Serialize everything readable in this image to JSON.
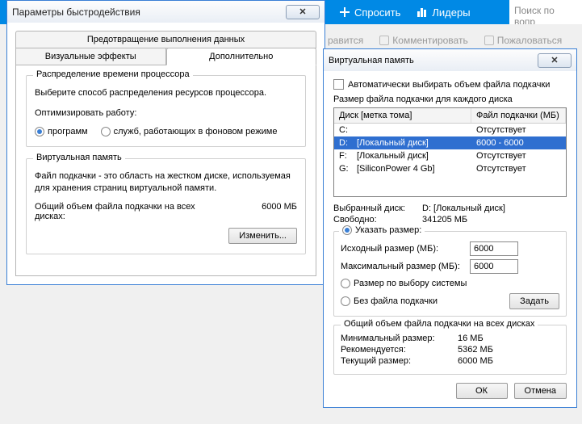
{
  "topbar": {
    "ask": "Спросить",
    "leaders": "Лидеры",
    "search_placeholder": "Поиск по вопр"
  },
  "actions": {
    "like": "равится",
    "comment": "Комментировать",
    "report": "Пожаловаться"
  },
  "dlg1": {
    "title": "Параметры быстродействия",
    "close": "✕",
    "tab_top": "Предотвращение выполнения данных",
    "tab_fx": "Визуальные эффекты",
    "tab_adv": "Дополнительно",
    "cpu": {
      "legend": "Распределение времени процессора",
      "desc": "Выберите способ распределения ресурсов процессора.",
      "opt": "Оптимизировать работу:",
      "programs": "программ",
      "services": "служб, работающих в фоновом режиме"
    },
    "vm": {
      "legend": "Виртуальная память",
      "desc": "Файл подкачки - это область на жестком диске, используемая для хранения страниц виртуальной памяти.",
      "total_lbl": "Общий объем файла подкачки на всех дисках:",
      "total_val": "6000 МБ",
      "change": "Изменить..."
    }
  },
  "dlg2": {
    "title": "Виртуальная память",
    "close": "✕",
    "auto": "Автоматически выбирать объем файла подкачки",
    "size_each": "Размер файла подкачки для каждого диска",
    "hdr_drive": "Диск [метка тома]",
    "hdr_size": "Файл подкачки (МБ)",
    "rows": [
      {
        "d": "C:",
        "l": "",
        "s": "Отсутствует"
      },
      {
        "d": "D:",
        "l": "[Локальный диск]",
        "s": "6000 - 6000"
      },
      {
        "d": "F:",
        "l": "[Локальный диск]",
        "s": "Отсутствует"
      },
      {
        "d": "G:",
        "l": "[SiliconPower 4 Gb]",
        "s": "Отсутствует"
      }
    ],
    "sel_lbl": "Выбранный диск:",
    "sel_val": "D:   [Локальный диск]",
    "free_lbl": "Свободно:",
    "free_val": "341205 МБ",
    "r_custom": "Указать размер:",
    "init_lbl": "Исходный размер (МБ):",
    "init_val": "6000",
    "max_lbl": "Максимальный размер (МБ):",
    "max_val": "6000",
    "r_system": "Размер по выбору системы",
    "r_none": "Без файла подкачки",
    "set": "Задать",
    "total": {
      "legend": "Общий объем файла подкачки на всех дисках",
      "min_lbl": "Минимальный размер:",
      "min_val": "16 МБ",
      "rec_lbl": "Рекомендуется:",
      "rec_val": "5362 МБ",
      "cur_lbl": "Текущий размер:",
      "cur_val": "6000 МБ"
    },
    "ok": "ОК",
    "cancel": "Отмена"
  }
}
